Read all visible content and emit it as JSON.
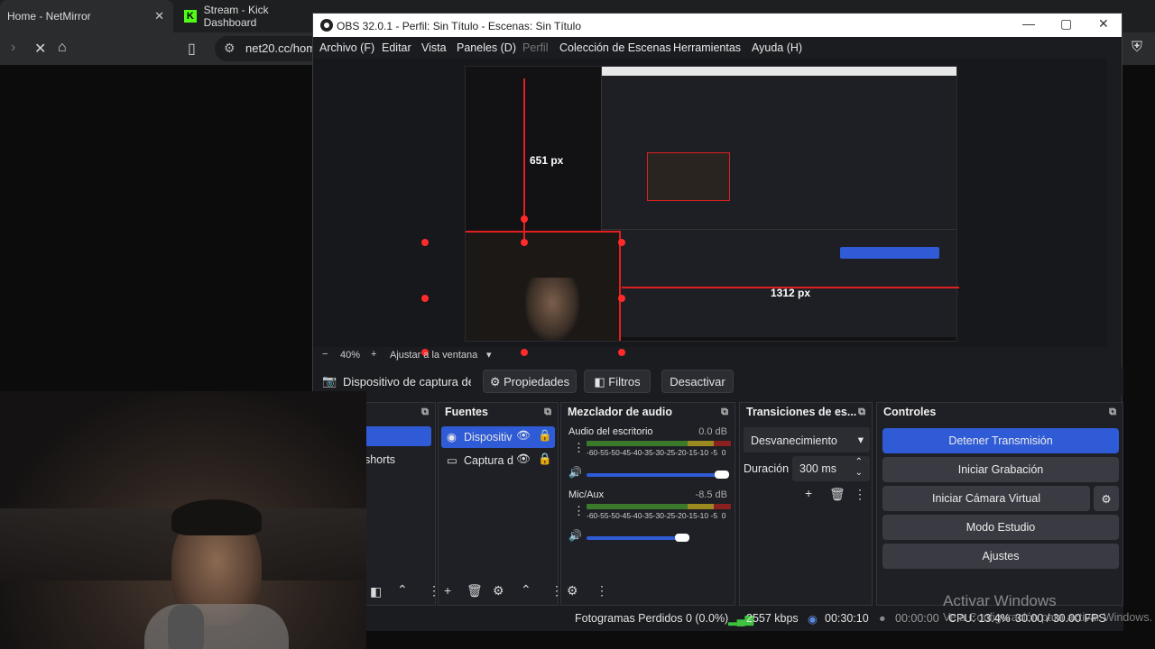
{
  "browser": {
    "tabs": [
      {
        "label": "Home - NetMirror"
      },
      {
        "label": "Stream - Kick Dashboard"
      }
    ],
    "url": "net20.cc/hom"
  },
  "obs": {
    "title": "OBS 32.0.1 - Perfil: Sin Título - Escenas: Sin Título",
    "menu": [
      "Archivo (F)",
      "Editar",
      "Vista",
      "Paneles (D)",
      "Perfil",
      "Colección de Escenas",
      "Herramientas",
      "Ayuda (H)"
    ],
    "preview": {
      "measure_v": "651 px",
      "measure_h": "1312 px",
      "zoom": "40%",
      "fit": "Ajustar a la ventana"
    },
    "source_bar": {
      "name": "Dispositivo de captura de v",
      "properties": "Propiedades",
      "filters": "Filtros",
      "deactivate": "Desactivar"
    },
    "scenes": {
      "item_partial": "shorts"
    },
    "sources": {
      "title": "Fuentes",
      "items": [
        "Dispositiv",
        "Captura d"
      ]
    },
    "mixer": {
      "title": "Mezclador de audio",
      "channels": [
        {
          "name": "Audio del escritorio",
          "db": "0.0 dB",
          "level": 0.95
        },
        {
          "name": "Mic/Aux",
          "db": "-8.5 dB",
          "level": 0.72
        }
      ],
      "scale": "-60-55-50-45-40-35-30-25-20-15-10 -5  0"
    },
    "transitions": {
      "title": "Transiciones de es...",
      "selected": "Desvanecimiento",
      "duration_label": "Duración",
      "duration": "300 ms"
    },
    "controls": {
      "title": "Controles",
      "stop_stream": "Detener Transmisión",
      "start_recording": "Iniciar Grabación",
      "start_virtualcam": "Iniciar Cámara Virtual",
      "studio_mode": "Modo Estudio",
      "settings": "Ajustes"
    },
    "status": {
      "dropped": "Fotogramas Perdidos 0 (0.0%)",
      "bitrate": "2557 kbps",
      "stream_time": "00:30:10",
      "rec_time": "00:00:00",
      "cpu": "CPU: 13.4%",
      "fps": "30.00 / 30.00 FPS"
    },
    "accent": "#2f5bd6"
  },
  "watermark": {
    "line1": "Activar Windows",
    "line2": "Ve a Configuración para activar Windows."
  }
}
